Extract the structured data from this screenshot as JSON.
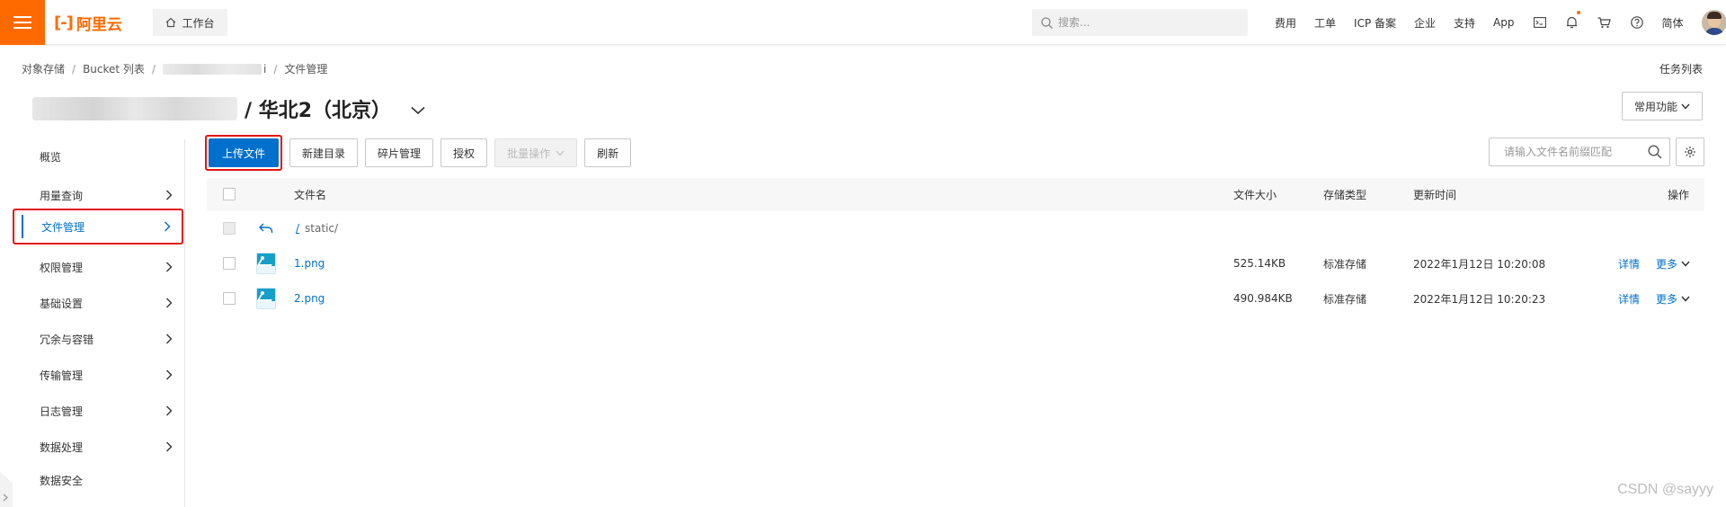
{
  "topbar": {
    "logo_text": "阿里云",
    "workbench_label": "工作台",
    "search_placeholder": "搜索...",
    "nav": [
      "费用",
      "工单",
      "ICP 备案",
      "企业",
      "支持",
      "App"
    ],
    "lang": "简体",
    "brand_color": "#ff6a00"
  },
  "breadcrumb": {
    "items": [
      "对象存储",
      "Bucket 列表",
      "i",
      "文件管理"
    ]
  },
  "task_list_label": "任务列表",
  "title": {
    "region": "/ 华北2（北京）"
  },
  "common_func_label": "常用功能",
  "sidebar": {
    "items": [
      {
        "label": "概览"
      },
      {
        "label": "用量查询"
      },
      {
        "label": "文件管理"
      },
      {
        "label": "权限管理"
      },
      {
        "label": "基础设置"
      },
      {
        "label": "冗余与容错"
      },
      {
        "label": "传输管理"
      },
      {
        "label": "日志管理"
      },
      {
        "label": "数据处理"
      },
      {
        "label": "数据安全"
      }
    ],
    "active": "文件管理"
  },
  "toolbar": {
    "upload": "上传文件",
    "new_dir": "新建目录",
    "fragments": "碎片管理",
    "authorize": "授权",
    "batch": "批量操作",
    "refresh": "刷新"
  },
  "file_search_placeholder": "请输入文件名前缀匹配",
  "table": {
    "headers": {
      "name": "文件名",
      "size": "文件大小",
      "storage": "存储类型",
      "updated": "更新时间",
      "actions": "操作"
    },
    "parent_row": {
      "slash": "/",
      "path": "static/"
    },
    "rows": [
      {
        "name": "1.png",
        "size": "525.14KB",
        "storage": "标准存储",
        "updated": "2022年1月12日 10:20:08",
        "detail": "详情",
        "more": "更多"
      },
      {
        "name": "2.png",
        "size": "490.984KB",
        "storage": "标准存储",
        "updated": "2022年1月12日 10:20:23",
        "detail": "详情",
        "more": "更多"
      }
    ]
  },
  "watermark": "CSDN @sayyy",
  "colors": {
    "accent_blue": "#0070cc",
    "highlight_red": "#e3150f"
  }
}
